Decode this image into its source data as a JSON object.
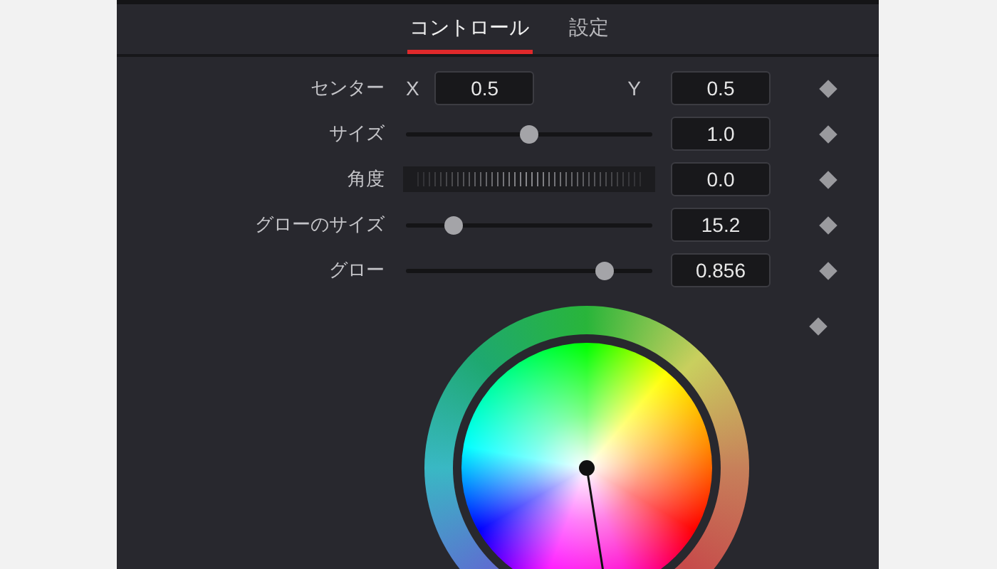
{
  "tabs": [
    {
      "label": "コントロール",
      "selected": true
    },
    {
      "label": "設定",
      "selected": false
    }
  ],
  "controls": [
    {
      "kind": "point",
      "label": "センター",
      "x_label": "X",
      "x_value": "0.5",
      "y_label": "Y",
      "y_value": "0.5"
    },
    {
      "kind": "slider",
      "label": "サイズ",
      "level": 0.5,
      "value": "1.0"
    },
    {
      "kind": "dial",
      "label": "角度",
      "value": "0.0"
    },
    {
      "kind": "slider",
      "label": "グローのサイズ",
      "level": 0.17,
      "value": "15.2"
    },
    {
      "kind": "slider",
      "label": "グロー",
      "level": 0.83,
      "value": "0.856"
    },
    {
      "kind": "color"
    }
  ]
}
